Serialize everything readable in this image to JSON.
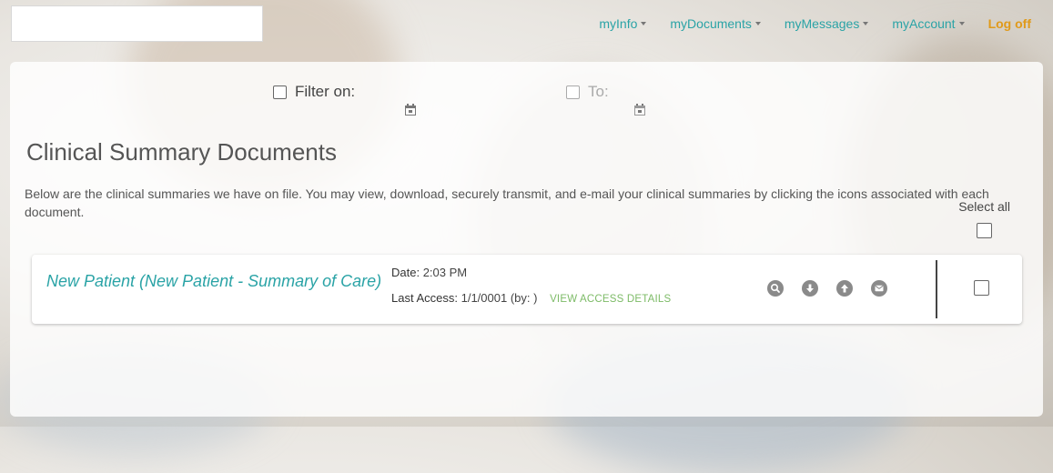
{
  "nav": {
    "items": [
      {
        "label": "myInfo",
        "dropdown": true
      },
      {
        "label": "myDocuments",
        "dropdown": true
      },
      {
        "label": "myMessages",
        "dropdown": true
      },
      {
        "label": "myAccount",
        "dropdown": true
      }
    ],
    "logoff": "Log off"
  },
  "filters": {
    "filter_on_label": "Filter on:",
    "to_label": "To:"
  },
  "page": {
    "title": "Clinical Summary Documents",
    "description": "Below are the clinical summaries we have on file. You may view, download, securely transmit, and e-mail your clinical summaries by clicking the icons associated with each document.",
    "select_all": "Select all"
  },
  "documents": [
    {
      "title": "New Patient (New Patient - Summary of Care)",
      "date_label": "Date:",
      "date_value": "2:03 PM",
      "last_access_label": "Last Access:",
      "last_access_value": "1/1/0001 (by: )",
      "view_access": "VIEW ACCESS DETAILS",
      "actions": [
        "search-icon",
        "download-icon",
        "upload-icon",
        "email-icon"
      ]
    }
  ],
  "colors": {
    "link": "#2aa3a6",
    "logoff": "#e09a1a",
    "view_access": "#7dbb67",
    "icon": "#8a8a8a"
  }
}
